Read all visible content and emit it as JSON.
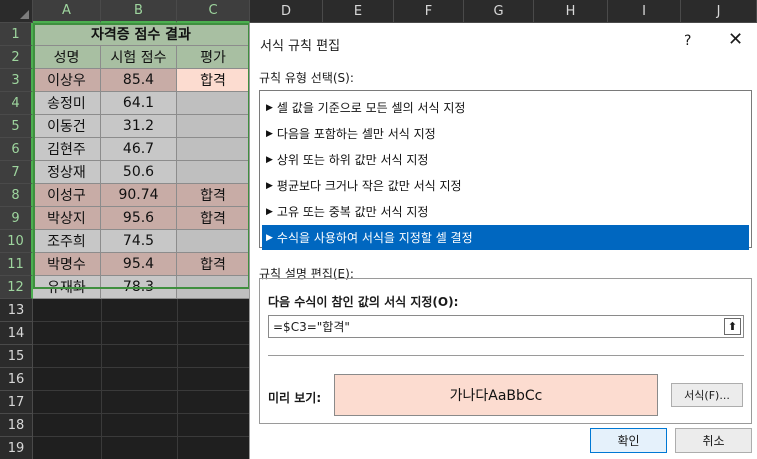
{
  "columns": [
    "A",
    "B",
    "C",
    "D",
    "E",
    "F",
    "G",
    "H",
    "I",
    "J"
  ],
  "rows": [
    "1",
    "2",
    "3",
    "4",
    "5",
    "6",
    "7",
    "8",
    "9",
    "10",
    "11",
    "12",
    "13",
    "14",
    "15",
    "16",
    "17",
    "18",
    "19"
  ],
  "sheet": {
    "title": "자격증 점수 결과",
    "headers": [
      "성명",
      "시험 점수",
      "평가"
    ],
    "records": [
      {
        "name": "이상우",
        "score": "85.4",
        "eval": "합격"
      },
      {
        "name": "송정미",
        "score": "64.1",
        "eval": ""
      },
      {
        "name": "이동건",
        "score": "31.2",
        "eval": ""
      },
      {
        "name": "김현주",
        "score": "46.7",
        "eval": ""
      },
      {
        "name": "정상재",
        "score": "50.6",
        "eval": ""
      },
      {
        "name": "이성구",
        "score": "90.74",
        "eval": "합격"
      },
      {
        "name": "박상지",
        "score": "95.6",
        "eval": "합격"
      },
      {
        "name": "조주희",
        "score": "74.5",
        "eval": ""
      },
      {
        "name": "박명수",
        "score": "95.4",
        "eval": "합격"
      },
      {
        "name": "유재화",
        "score": "78.3",
        "eval": ""
      }
    ]
  },
  "dialog": {
    "title": "서식 규칙 편집",
    "help": "?",
    "close": "✕",
    "rule_type_label": "규칙 유형 선택(S):",
    "rules": [
      "셀 값을 기준으로 모든 셀의 서식 지정",
      "다음을 포함하는 셀만 서식 지정",
      "상위 또는 하위 값만 서식 지정",
      "평균보다 크거나 작은 값만 서식 지정",
      "고유 또는 중복 값만 서식 지정",
      "수식을 사용하여 서식을 지정할 셀 결정"
    ],
    "selected_rule_index": 5,
    "rule_desc_label": "규칙 설명 편집(E):",
    "formula_label": "다음 수식이 참인 값의 서식 지정(O):",
    "formula_value": "=$C3=\"합격\"",
    "preview_label": "미리 보기:",
    "preview_text": "가나다AaBbCc",
    "preview_color": "#fcdcd0",
    "format_button": "서식(F)...",
    "ok_button": "확인",
    "cancel_button": "취소"
  }
}
